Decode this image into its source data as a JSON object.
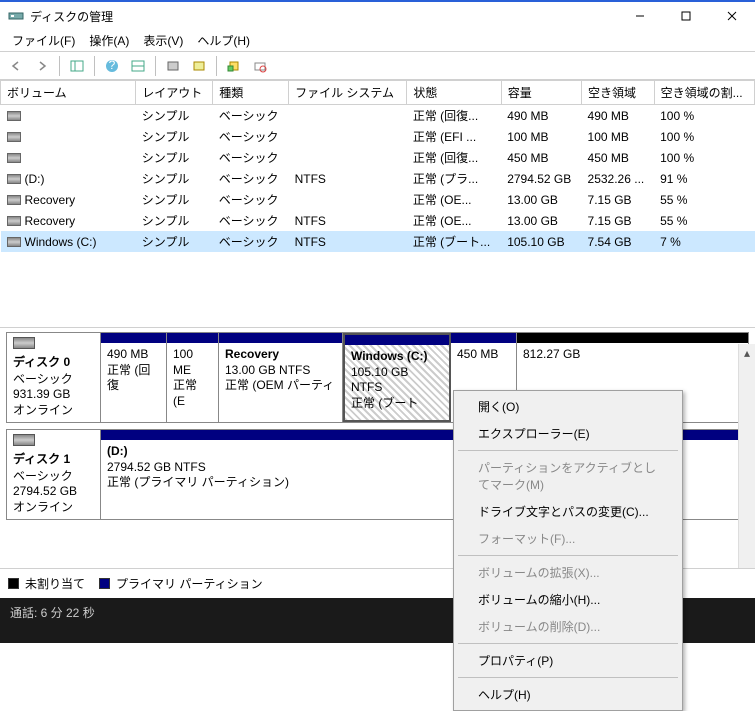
{
  "window": {
    "title": "ディスクの管理"
  },
  "menu": {
    "file": "ファイル(F)",
    "action": "操作(A)",
    "view": "表示(V)",
    "help": "ヘルプ(H)"
  },
  "columns": {
    "volume": "ボリューム",
    "layout": "レイアウト",
    "type": "種類",
    "filesystem": "ファイル システム",
    "state": "状態",
    "capacity": "容量",
    "free": "空き領域",
    "free_pct": "空き領域の割..."
  },
  "volumes": [
    {
      "name": "",
      "layout": "シンプル",
      "type": "ベーシック",
      "fs": "",
      "state": "正常 (回復...",
      "cap": "490 MB",
      "free": "490 MB",
      "pct": "100 %"
    },
    {
      "name": "",
      "layout": "シンプル",
      "type": "ベーシック",
      "fs": "",
      "state": "正常 (EFI ...",
      "cap": "100 MB",
      "free": "100 MB",
      "pct": "100 %"
    },
    {
      "name": "",
      "layout": "シンプル",
      "type": "ベーシック",
      "fs": "",
      "state": "正常 (回復...",
      "cap": "450 MB",
      "free": "450 MB",
      "pct": "100 %"
    },
    {
      "name": "(D:)",
      "layout": "シンプル",
      "type": "ベーシック",
      "fs": "NTFS",
      "state": "正常 (プラ...",
      "cap": "2794.52 GB",
      "free": "2532.26 ...",
      "pct": "91 %"
    },
    {
      "name": "Recovery",
      "layout": "シンプル",
      "type": "ベーシック",
      "fs": "",
      "state": "正常 (OE...",
      "cap": "13.00 GB",
      "free": "7.15 GB",
      "pct": "55 %"
    },
    {
      "name": "Recovery",
      "layout": "シンプル",
      "type": "ベーシック",
      "fs": "NTFS",
      "state": "正常 (OE...",
      "cap": "13.00 GB",
      "free": "7.15 GB",
      "pct": "55 %"
    },
    {
      "name": "Windows (C:)",
      "layout": "シンプル",
      "type": "ベーシック",
      "fs": "NTFS",
      "state": "正常 (ブート...",
      "cap": "105.10 GB",
      "free": "7.54 GB",
      "pct": "7 %"
    }
  ],
  "disks": {
    "d0": {
      "name": "ディスク 0",
      "type": "ベーシック",
      "size": "931.39 GB",
      "status": "オンライン"
    },
    "d1": {
      "name": "ディスク 1",
      "type": "ベーシック",
      "size": "2794.52 GB",
      "status": "オンライン"
    }
  },
  "parts0": {
    "p0": {
      "l1": "",
      "l2": "490 MB",
      "l3": "正常 (回復"
    },
    "p1": {
      "l1": "",
      "l2": "100 ME",
      "l3": "正常 (E"
    },
    "p2": {
      "l1": "Recovery",
      "l2": "13.00 GB NTFS",
      "l3": "正常 (OEM パーティ"
    },
    "p3": {
      "l1": "Windows  (C:)",
      "l2": "105.10 GB NTFS",
      "l3": "正常 (ブート"
    },
    "p4": {
      "l1": "",
      "l2": "450 MB",
      "l3": ""
    },
    "p5": {
      "l1": "",
      "l2": "812.27 GB",
      "l3": ""
    }
  },
  "parts1": {
    "p0": {
      "l1": "(D:)",
      "l2": "2794.52 GB NTFS",
      "l3": "正常 (プライマリ パーティション)"
    }
  },
  "legend": {
    "unalloc": "未割り当て",
    "primary": "プライマリ パーティション"
  },
  "ctx": {
    "open": "開く(O)",
    "explorer": "エクスプローラー(E)",
    "mark_active": "パーティションをアクティブとしてマーク(M)",
    "change_drive": "ドライブ文字とパスの変更(C)...",
    "format": "フォーマット(F)...",
    "extend": "ボリュームの拡張(X)...",
    "shrink": "ボリュームの縮小(H)...",
    "delete": "ボリュームの削除(D)...",
    "properties": "プロパティ(P)",
    "help": "ヘルプ(H)"
  },
  "bottom": {
    "call": "通話: 6 分 22 秒"
  }
}
